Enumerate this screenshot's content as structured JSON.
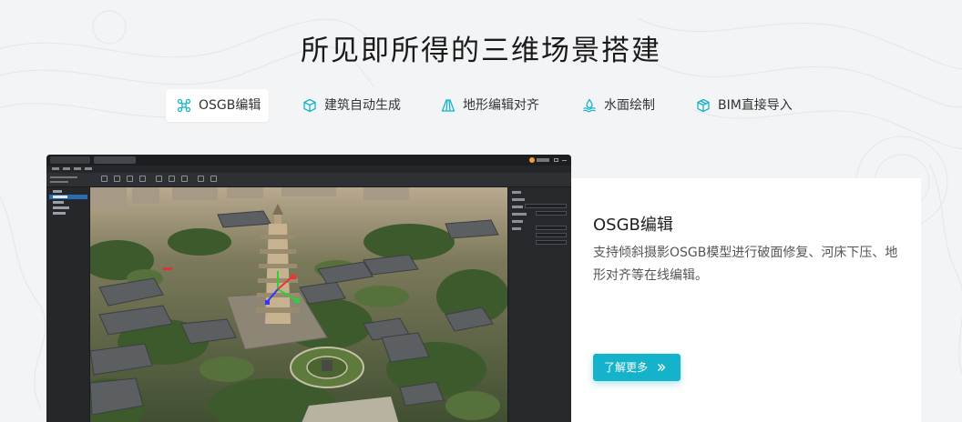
{
  "page_title": "所见即所得的三维场景搭建",
  "colors": {
    "accent": "#14b3cb",
    "background": "#f3f4f6",
    "card": "#ffffff"
  },
  "tabs": [
    {
      "label": "OSGB编辑",
      "icon": "drone-icon",
      "active": true
    },
    {
      "label": "建筑自动生成",
      "icon": "cube-icon",
      "active": false
    },
    {
      "label": "地形编辑对齐",
      "icon": "terrain-icon",
      "active": false
    },
    {
      "label": "水面绘制",
      "icon": "water-icon",
      "active": false
    },
    {
      "label": "BIM直接导入",
      "icon": "bim-cube-icon",
      "active": false
    }
  ],
  "feature": {
    "title": "OSGB编辑",
    "description": "支持倾斜摄影OSGB模型进行破面修复、河床下压、地形对齐等在线编辑。",
    "more_button": "了解更多",
    "more_icon": "double-chevron-right-icon"
  },
  "screenshot": {
    "subject": "3d-editor-oblique-photography-pagoda-scene"
  }
}
